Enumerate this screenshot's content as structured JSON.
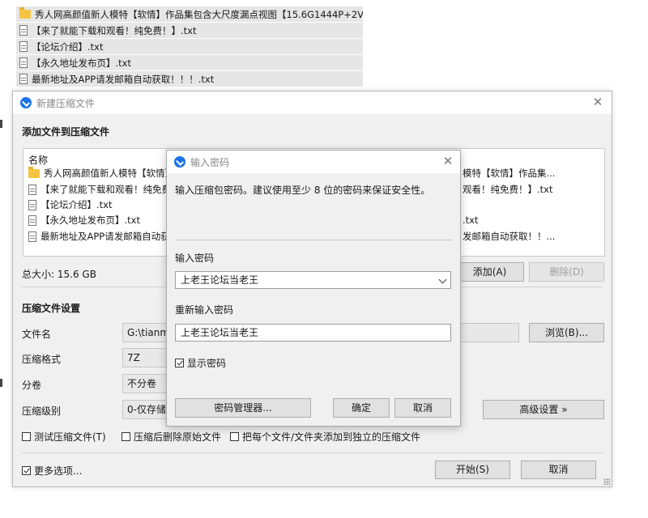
{
  "background_list": {
    "items": [
      {
        "type": "folder",
        "name": "秀人网高颜值新人模特【软情】作品集包含大尺度漏点视图【15.6G1444P+2V】"
      },
      {
        "type": "file",
        "name": "【来了就能下载和观看！纯免费！】.txt"
      },
      {
        "type": "file",
        "name": "【论坛介绍】.txt"
      },
      {
        "type": "file",
        "name": "【永久地址发布页】.txt"
      },
      {
        "type": "file",
        "name": "最新地址及APP请发邮箱自动获取！！！.txt"
      }
    ]
  },
  "main_window": {
    "title": "新建压缩文件",
    "section_add": "添加文件到压缩文件",
    "file_list": {
      "column_header": "名称",
      "rows": [
        {
          "type": "folder",
          "left": "秀人网高颜值新人模特【软情】",
          "right": "模特【软情】作品集..."
        },
        {
          "type": "file",
          "left": "【来了就能下载和观看！纯免费",
          "right": "观看！纯免费！】.txt"
        },
        {
          "type": "file",
          "left": "【论坛介绍】.txt",
          "right": ""
        },
        {
          "type": "file",
          "left": "【永久地址发布页】.txt",
          "right": ".txt"
        },
        {
          "type": "file",
          "left": "最新地址及APP请发邮箱自动获",
          "right": "发邮箱自动获取！！..."
        }
      ]
    },
    "total_size": "总大小: 15.6 GB",
    "add_button": "添加(A)",
    "delete_button": "删除(D)",
    "section_settings": "压缩文件设置",
    "filename_label": "文件名",
    "filename_value": "G:\\tianme",
    "browse_button": "浏览(B)...",
    "format_label": "压缩格式",
    "format_value": "7Z",
    "split_label": "分卷",
    "split_value": "不分卷",
    "level_label": "压缩级别",
    "level_value": "0-仅存储",
    "advanced_button": "高级设置 »",
    "opt_test": "测试压缩文件(T)",
    "opt_delete": "压缩后删除原始文件",
    "opt_each": "把每个文件/文件夹添加到独立的压缩文件",
    "more_options": "更多选项...",
    "start_button": "开始(S)",
    "cancel_button": "取消"
  },
  "password_dialog": {
    "title": "输入密码",
    "description": "输入压缩包密码。建议使用至少 8 位的密码来保证安全性。",
    "password_label": "输入密码",
    "password_value": "上老王论坛当老王",
    "confirm_label": "重新输入密码",
    "confirm_value": "上老王论坛当老王",
    "show_password": "显示密码",
    "manager_button": "密码管理器...",
    "ok_button": "确定",
    "cancel_button": "取消"
  }
}
